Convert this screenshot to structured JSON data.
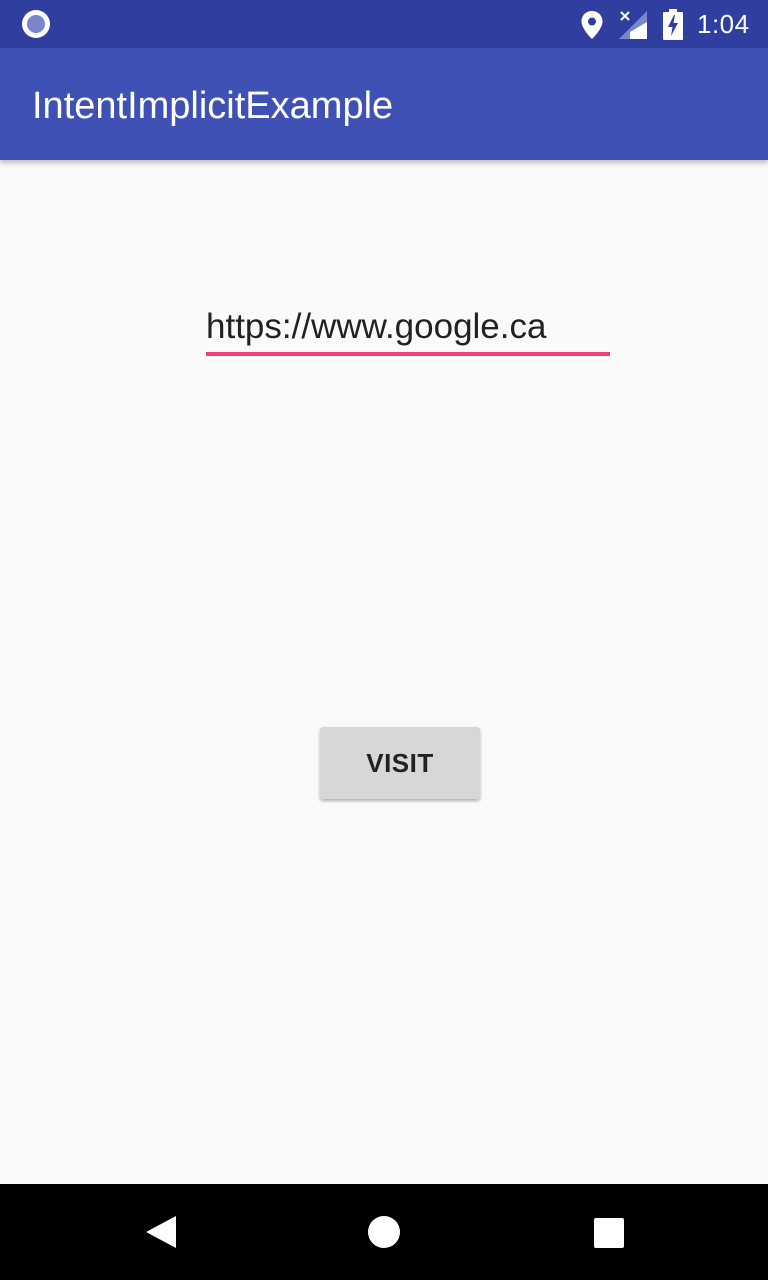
{
  "status_bar": {
    "time": "1:04",
    "icons": [
      "notification-circle-icon",
      "location-icon",
      "signal-no-sim-icon",
      "battery-charging-icon"
    ],
    "background": "#303f9f"
  },
  "app_bar": {
    "title": "IntentImplicitExample",
    "background": "#3f51b5"
  },
  "main": {
    "url_input": {
      "value": "https://www.google.ca",
      "underline_color": "#ec407a"
    },
    "visit_button_label": "VISIT"
  },
  "nav_bar": {
    "buttons": [
      "back-icon",
      "home-icon",
      "recents-icon"
    ]
  }
}
